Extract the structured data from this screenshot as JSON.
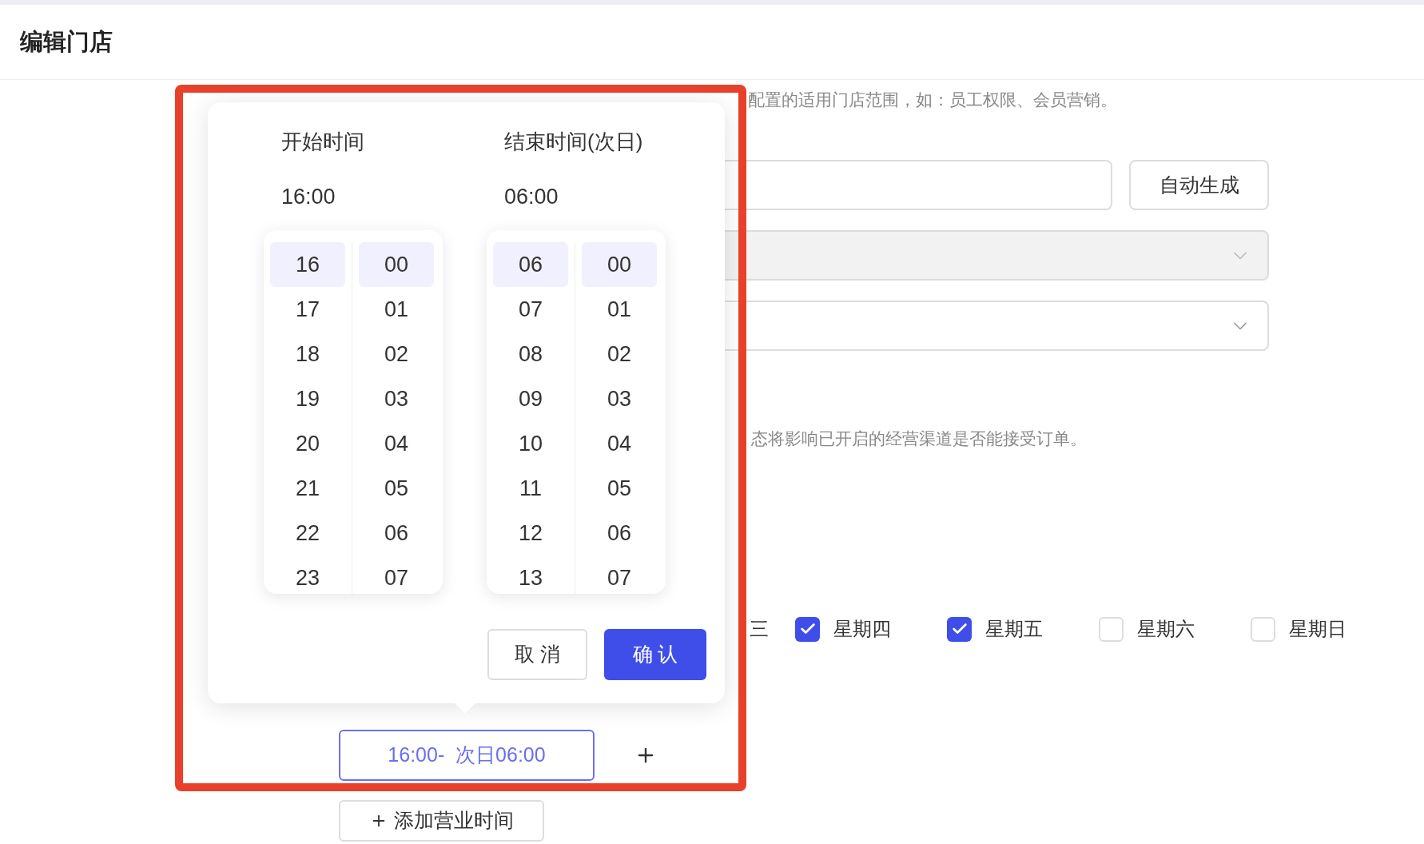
{
  "page": {
    "title": "编辑门店"
  },
  "form": {
    "org_hint": "配置的适用门店范围，如：员工权限、会员营销。",
    "code_button": "自动生成",
    "selects": [
      {
        "disabled": true
      },
      {
        "disabled": false
      }
    ],
    "status_hint": "态将影响已开启的经营渠道是否能接受订单。",
    "weekday_fragment": "三",
    "weekdays": [
      {
        "label": "星期四",
        "checked": true
      },
      {
        "label": "星期五",
        "checked": true
      },
      {
        "label": "星期六",
        "checked": false
      },
      {
        "label": "星期日",
        "checked": false
      }
    ],
    "time_range": "16:00-  次日06:00",
    "add_button": "添加营业时间"
  },
  "time_picker": {
    "columns": [
      {
        "title": "开始时间",
        "value": "16:00",
        "hours": [
          {
            "label": "16",
            "selected": true
          },
          {
            "label": "17",
            "selected": false
          },
          {
            "label": "18",
            "selected": false
          },
          {
            "label": "19",
            "selected": false
          },
          {
            "label": "20",
            "selected": false
          },
          {
            "label": "21",
            "selected": false
          },
          {
            "label": "22",
            "selected": false
          },
          {
            "label": "23",
            "selected": false
          }
        ],
        "minutes": [
          {
            "label": "00",
            "selected": true
          },
          {
            "label": "01",
            "selected": false
          },
          {
            "label": "02",
            "selected": false
          },
          {
            "label": "03",
            "selected": false
          },
          {
            "label": "04",
            "selected": false
          },
          {
            "label": "05",
            "selected": false
          },
          {
            "label": "06",
            "selected": false
          },
          {
            "label": "07",
            "selected": false
          }
        ]
      },
      {
        "title": "结束时间(次日)",
        "value": "06:00",
        "hours": [
          {
            "label": "06",
            "selected": true
          },
          {
            "label": "07",
            "selected": false
          },
          {
            "label": "08",
            "selected": false
          },
          {
            "label": "09",
            "selected": false
          },
          {
            "label": "10",
            "selected": false
          },
          {
            "label": "11",
            "selected": false
          },
          {
            "label": "12",
            "selected": false
          },
          {
            "label": "13",
            "selected": false
          }
        ],
        "minutes": [
          {
            "label": "00",
            "selected": true
          },
          {
            "label": "01",
            "selected": false
          },
          {
            "label": "02",
            "selected": false
          },
          {
            "label": "03",
            "selected": false
          },
          {
            "label": "04",
            "selected": false
          },
          {
            "label": "05",
            "selected": false
          },
          {
            "label": "06",
            "selected": false
          },
          {
            "label": "07",
            "selected": false
          }
        ]
      }
    ],
    "buttons": [
      {
        "label": "取 消",
        "kind": "secondary"
      },
      {
        "label": "确 认",
        "kind": "primary"
      }
    ]
  }
}
